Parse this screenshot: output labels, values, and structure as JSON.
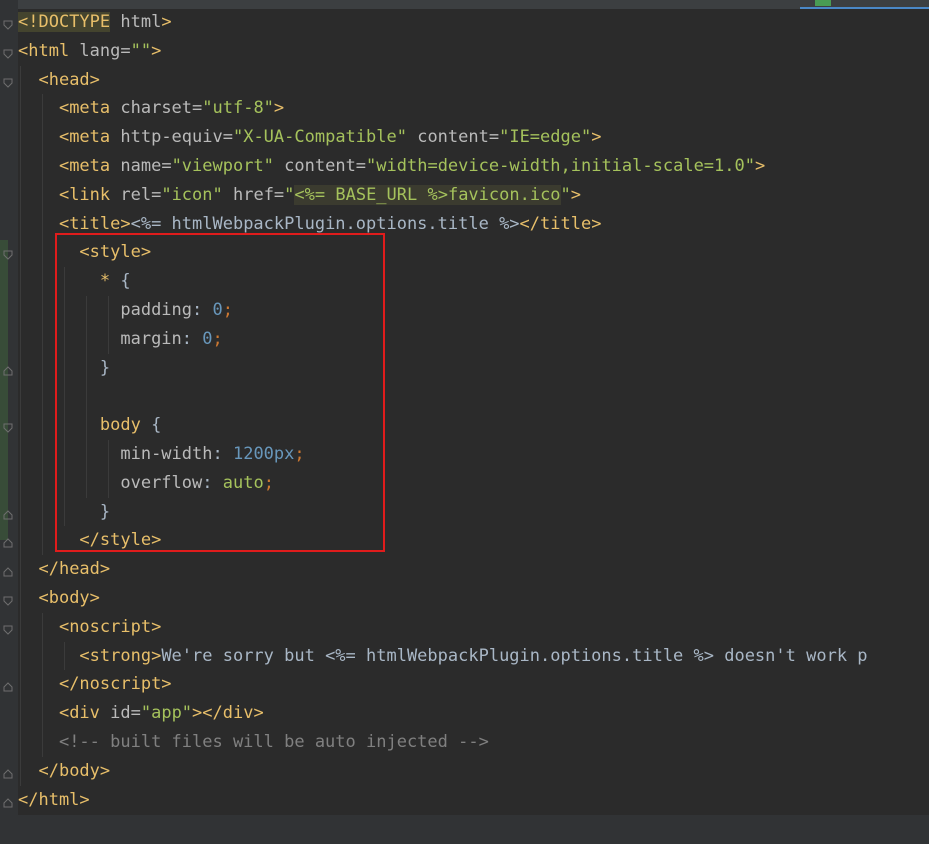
{
  "editor": {
    "language": "html",
    "lines": [
      [
        {
          "t": "<!DOCTYPE",
          "c": "tag hl2"
        },
        {
          "t": " html",
          "c": "attr"
        },
        {
          "t": ">",
          "c": "tag"
        }
      ],
      [
        {
          "t": "<html",
          "c": "tag"
        },
        {
          "t": " lang=",
          "c": "attr"
        },
        {
          "t": "\"\"",
          "c": "val"
        },
        {
          "t": ">",
          "c": "tag"
        }
      ],
      [
        {
          "t": "  "
        },
        {
          "t": "<head>",
          "c": "tag"
        }
      ],
      [
        {
          "t": "    "
        },
        {
          "t": "<meta",
          "c": "tag"
        },
        {
          "t": " charset=",
          "c": "attr"
        },
        {
          "t": "\"utf-8\"",
          "c": "val"
        },
        {
          "t": ">",
          "c": "tag"
        }
      ],
      [
        {
          "t": "    "
        },
        {
          "t": "<meta",
          "c": "tag"
        },
        {
          "t": " http-equiv=",
          "c": "attr"
        },
        {
          "t": "\"X-UA-Compatible\"",
          "c": "val"
        },
        {
          "t": " content=",
          "c": "attr"
        },
        {
          "t": "\"IE=edge\"",
          "c": "val"
        },
        {
          "t": ">",
          "c": "tag"
        }
      ],
      [
        {
          "t": "    "
        },
        {
          "t": "<meta",
          "c": "tag"
        },
        {
          "t": " name=",
          "c": "attr"
        },
        {
          "t": "\"viewport\"",
          "c": "val"
        },
        {
          "t": " content=",
          "c": "attr"
        },
        {
          "t": "\"width=device-width,initial-scale=1.0\"",
          "c": "val"
        },
        {
          "t": ">",
          "c": "tag"
        }
      ],
      [
        {
          "t": "    "
        },
        {
          "t": "<link",
          "c": "tag"
        },
        {
          "t": " rel=",
          "c": "attr"
        },
        {
          "t": "\"icon\"",
          "c": "val"
        },
        {
          "t": " href=",
          "c": "attr"
        },
        {
          "t": "\"",
          "c": "val"
        },
        {
          "t": "<%= BASE_URL %>",
          "c": "val hl"
        },
        {
          "t": "favicon.ico",
          "c": "val hl"
        },
        {
          "t": "\"",
          "c": "val"
        },
        {
          "t": ">",
          "c": "tag"
        }
      ],
      [
        {
          "t": "    "
        },
        {
          "t": "<title>",
          "c": "tag"
        },
        {
          "t": "<%= htmlWebpackPlugin.options.title %>",
          "c": "text"
        },
        {
          "t": "</title>",
          "c": "tag"
        }
      ],
      [
        {
          "t": "      "
        },
        {
          "t": "<style>",
          "c": "tag"
        }
      ],
      [
        {
          "t": "        "
        },
        {
          "t": "* ",
          "c": "tag"
        },
        {
          "t": "{",
          "c": "text"
        }
      ],
      [
        {
          "t": "          "
        },
        {
          "t": "padding",
          "c": "attr"
        },
        {
          "t": ": ",
          "c": "text"
        },
        {
          "t": "0",
          "c": "num"
        },
        {
          "t": ";",
          "c": "kw"
        }
      ],
      [
        {
          "t": "          "
        },
        {
          "t": "margin",
          "c": "attr"
        },
        {
          "t": ": ",
          "c": "text"
        },
        {
          "t": "0",
          "c": "num"
        },
        {
          "t": ";",
          "c": "kw"
        }
      ],
      [
        {
          "t": "        "
        },
        {
          "t": "}",
          "c": "text"
        }
      ],
      [
        {
          "t": ""
        }
      ],
      [
        {
          "t": "        "
        },
        {
          "t": "body",
          "c": "tag"
        },
        {
          "t": " {",
          "c": "text"
        }
      ],
      [
        {
          "t": "          "
        },
        {
          "t": "min-width",
          "c": "attr"
        },
        {
          "t": ": ",
          "c": "text"
        },
        {
          "t": "1200px",
          "c": "num"
        },
        {
          "t": ";",
          "c": "kw"
        }
      ],
      [
        {
          "t": "          "
        },
        {
          "t": "overflow",
          "c": "attr"
        },
        {
          "t": ": ",
          "c": "text"
        },
        {
          "t": "auto",
          "c": "val"
        },
        {
          "t": ";",
          "c": "kw"
        }
      ],
      [
        {
          "t": "        "
        },
        {
          "t": "}",
          "c": "text"
        }
      ],
      [
        {
          "t": "      "
        },
        {
          "t": "</style>",
          "c": "tag"
        }
      ],
      [
        {
          "t": "  "
        },
        {
          "t": "</head>",
          "c": "tag"
        }
      ],
      [
        {
          "t": "  "
        },
        {
          "t": "<body>",
          "c": "tag"
        }
      ],
      [
        {
          "t": "    "
        },
        {
          "t": "<noscript>",
          "c": "tag"
        }
      ],
      [
        {
          "t": "      "
        },
        {
          "t": "<strong>",
          "c": "tag"
        },
        {
          "t": "We're sorry but <%= htmlWebpackPlugin.options.title %> doesn't work p",
          "c": "text"
        }
      ],
      [
        {
          "t": "    "
        },
        {
          "t": "</noscript>",
          "c": "tag"
        }
      ],
      [
        {
          "t": "    "
        },
        {
          "t": "<div",
          "c": "tag"
        },
        {
          "t": " id=",
          "c": "attr"
        },
        {
          "t": "\"app\"",
          "c": "val"
        },
        {
          "t": "></div>",
          "c": "tag"
        }
      ],
      [
        {
          "t": "    "
        },
        {
          "t": "<!-- built files will be auto injected -->",
          "c": "cmt"
        }
      ],
      [
        {
          "t": "  "
        },
        {
          "t": "</body>",
          "c": "tag"
        }
      ],
      [
        {
          "t": "</html>",
          "c": "tag"
        }
      ]
    ]
  },
  "colors": {
    "background": "#2b2b2b",
    "highlight_box": "#e01c1c"
  },
  "icons": {
    "fold_markers": "fold-marker-icon"
  }
}
